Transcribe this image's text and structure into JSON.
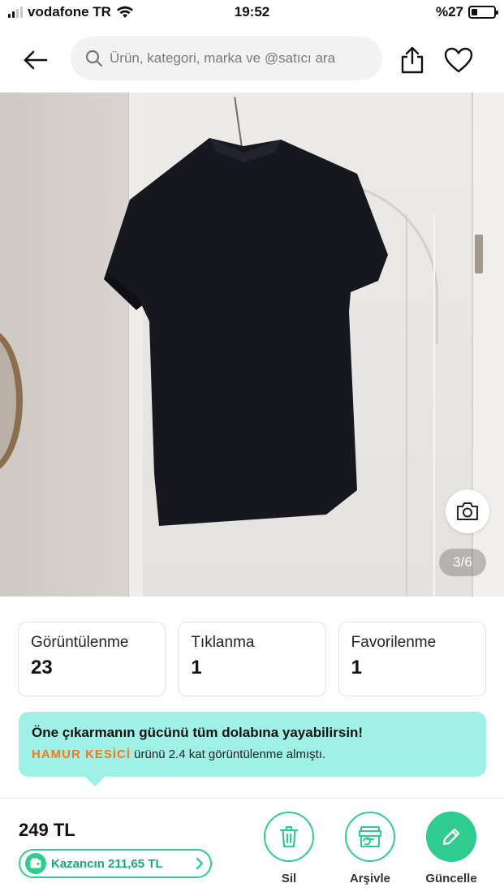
{
  "status_bar": {
    "carrier": "vodafone TR",
    "time": "19:52",
    "battery": "%27",
    "battery_level": 0.27
  },
  "header": {
    "search_placeholder": "Ürün, kategori, marka ve @satıcı ara",
    "icons": [
      "back-arrow-icon",
      "search-icon",
      "share-icon",
      "heart-icon"
    ]
  },
  "photo": {
    "counter": "3/6",
    "icons": [
      "camera-icon"
    ]
  },
  "stats": [
    {
      "label": "Görüntülenme",
      "value": "23"
    },
    {
      "label": "Tıklanma",
      "value": "1"
    },
    {
      "label": "Favorilenme",
      "value": "1"
    }
  ],
  "promo": {
    "title": "Öne çıkarmanın gücünü tüm dolabına yayabilirsin!",
    "seller": "HAMUR KESİCİ",
    "text": " ürünü 2.4 kat görüntülenme almıştı."
  },
  "bottom_bar": {
    "price": "249 TL",
    "earnings": "Kazancın 211,65 TL",
    "actions": [
      {
        "label": "Sil",
        "icon": "trash-icon"
      },
      {
        "label": "Arşivle",
        "icon": "archive-icon"
      },
      {
        "label": "Güncelle",
        "icon": "pencil-icon"
      }
    ]
  },
  "colors": {
    "accent_green": "#2ecc8f",
    "promo_bg": "#9ff0e6",
    "seller_orange": "#f27a1a"
  }
}
